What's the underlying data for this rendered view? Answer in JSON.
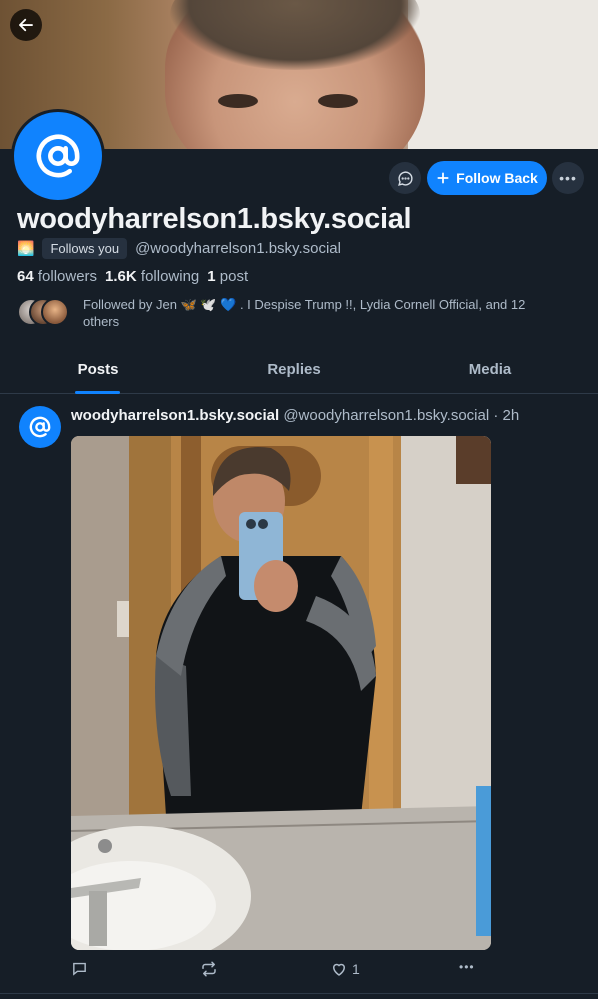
{
  "profile": {
    "display_name": "woodyharrelson1.bsky.social",
    "handle": "@woodyharrelson1.bsky.social",
    "status_emoji": "🌅",
    "follows_you_label": "Follows you",
    "followers_count": "64",
    "followers_label": "followers",
    "following_count": "1.6K",
    "following_label": "following",
    "posts_count": "1",
    "posts_label": "post",
    "followed_by_text": "Followed by Jen 🦋 🕊️ 💙 . I Despise Trump !!, Lydia Cornell Official, and 12 others"
  },
  "actions": {
    "follow_back_label": "Follow Back",
    "more_label": "•••"
  },
  "tabs": [
    {
      "label": "Posts",
      "active": true
    },
    {
      "label": "Replies",
      "active": false
    },
    {
      "label": "Media",
      "active": false
    }
  ],
  "post": {
    "author_name": "woodyharrelson1.bsky.social",
    "author_handle": "@woodyharrelson1.bsky.social",
    "separator": "·",
    "time": "2h",
    "like_count": "1"
  },
  "colors": {
    "accent": "#1083fe",
    "background": "#161e27",
    "muted_text": "#aebbc9"
  }
}
